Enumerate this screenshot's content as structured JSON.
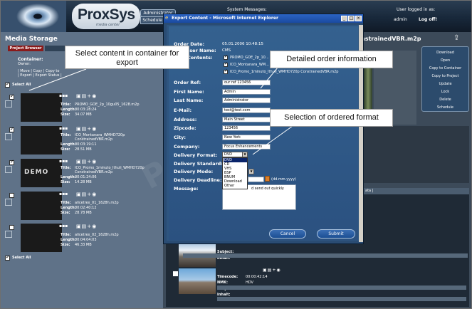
{
  "header": {
    "logo": "ProxSys",
    "logo_sub": "media center",
    "admin_button": "Administrator",
    "schedule_button": "Schedule",
    "system_messages": "System Messages:",
    "user_logged": "User logged in as:",
    "user_name": "admin",
    "logoff": "Log off!"
  },
  "left_panel": {
    "title": "Media Storage",
    "project_tab": "Project Browser",
    "container_label": "Container:",
    "owner_label": "Owner:",
    "actions_line1": "| Move | Copy | Copy to",
    "actions_line2": "| Export | Export Status |",
    "select_all": "Select All",
    "select_all_bottom": "Select All",
    "demo_overlay": "DEMO",
    "items": [
      {
        "title": "PROMO_GOE_2p_10gu05_1628.m2p",
        "length": "00:03:28:24",
        "size": "34.07 MB"
      },
      {
        "title": "ICO_Montanara_WMHD720p",
        "title2": "ConstrainedVBR.m2p",
        "length": "00:03:19:11",
        "size": "28.51 MB"
      },
      {
        "title": "ICO_Promo_1minuto_Ithuli_WMHD720p",
        "title2": "ConstrainedVBR.m2p",
        "length": "00:01:24:06",
        "size": "14.28 MB"
      },
      {
        "title": "alicetrex_01_1628h.m2p",
        "length": "00:02:40:12",
        "size": "28.78 MB"
      },
      {
        "title": "alicetrex_02_1628h.m2p",
        "length": "00:04:04:03",
        "size": "46.33 MB"
      }
    ],
    "labels": {
      "title": "Title:",
      "length": "Length:",
      "size": "Size:"
    }
  },
  "right_panel": {
    "title": "nstrainedVBR.m2p",
    "side_buttons": [
      "Download",
      "Open",
      "Copy to Container",
      "Copy to Project",
      "Update",
      "Lock",
      "Delete",
      "Schedule"
    ],
    "grid_tab": "ata |",
    "lower": {
      "subject_label": "Subject:",
      "inhalt_label": "Inhalt:",
      "timecode_label": "Timecode:",
      "nmk_label": "NMK:",
      "timecode_value": "00:00:42:14",
      "nmk_value": "HDV"
    }
  },
  "dialog": {
    "title": "Export Content - Microsoft Internet Explorer",
    "order_date_label": "Order Date:",
    "order_date_value": "05.01.2006 10:48:15",
    "user_name_label": "User Name:",
    "user_name_value": "CMS",
    "contents_label": "Contents:",
    "contents": [
      "PROMO_GOE_2p_10...",
      "ICO_Montanara_WM...",
      "ICO_Promo_1minuto_Ithuli_WMHD720p ConstrainedVBR.m2p"
    ],
    "order_ref_label": "Order Ref:",
    "order_ref_value": "our ref 123456",
    "first_name_label": "First Name:",
    "first_name_value": "Admin",
    "last_name_label": "Last Name:",
    "last_name_value": "Administrator",
    "email_label": "E-Mail:",
    "email_value": "test@test.com",
    "address_label": "Address:",
    "address_value": "Main Street",
    "zipcode_label": "Zipcode:",
    "zipcode_value": "123456",
    "city_label": "City:",
    "city_value": "New York",
    "company_label": "Company:",
    "company_value": "Focus Enhancements",
    "delivery_format_label": "Delivery Format:",
    "delivery_format_value": "DVD",
    "format_options": [
      "DVD",
      "CD",
      "VHS",
      "BSP",
      "BNUM",
      "Download",
      "Other"
    ],
    "delivery_standard_label": "Delivery Standard:",
    "delivery_mode_label": "Delivery Mode:",
    "delivery_deadline_label": "Delivery Deadline:",
    "date_format_hint": "(dd.mm.yyyy)",
    "message_label": "Message:",
    "message_value": "d send out quickly",
    "cancel_button": "Cancel",
    "submit_button": "Submit"
  },
  "callouts": {
    "select_content": "Select content in container for export",
    "order_info": "Detailed order information",
    "ordered_format": "Selection of ordered format"
  },
  "watermark": "ProxSys",
  "colors": {
    "header_bg": "#18283a",
    "panel_bg": "#5f7288",
    "dialog_bg": "#2e557f",
    "accent_red": "#8b1a1a"
  }
}
